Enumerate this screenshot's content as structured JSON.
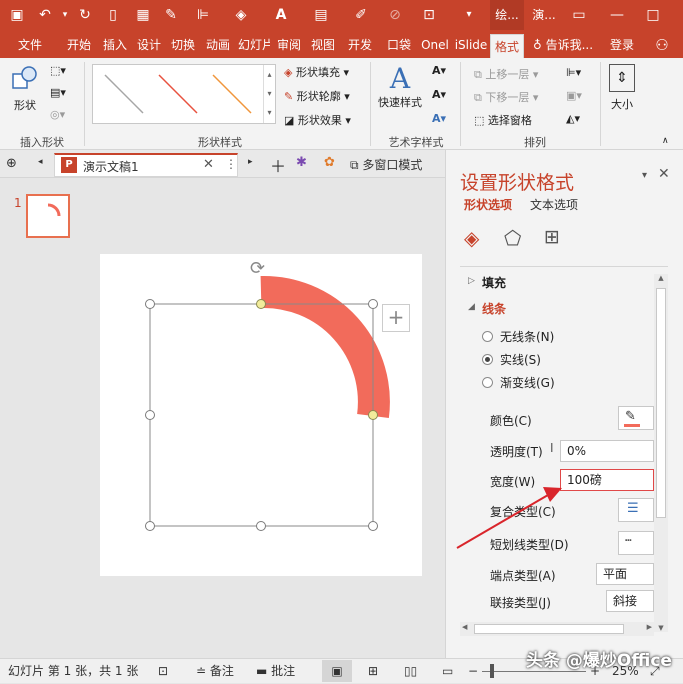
{
  "window": {
    "context_tabs": [
      "绘...",
      "演..."
    ],
    "quick_access_icons": [
      "save-icon",
      "undo-icon",
      "redo-icon",
      "new-icon",
      "table-icon",
      "eyedropper-icon",
      "align-icon",
      "fill-icon",
      "font-color-icon",
      "paste-icon",
      "brush-icon",
      "circle-icon",
      "screen-icon"
    ],
    "restore_icon": "restore-icon",
    "minimize_icon": "minimize-icon",
    "close_icon": "close-icon"
  },
  "ribbon_tabs": [
    "文件",
    "开始",
    "插入",
    "设计",
    "切换",
    "动画",
    "幻灯片",
    "审阅",
    "视图",
    "开发",
    "口袋",
    "Onel",
    "iSlide",
    "格式"
  ],
  "active_tab": "格式",
  "tell_me": "告诉我...",
  "login": "登录",
  "ribbon": {
    "insert_shape": {
      "shape_label": "形状",
      "group_label": "插入形状"
    },
    "shape_styles": {
      "fill": "形状填充",
      "outline": "形状轮廓",
      "effect": "形状效果",
      "group_label": "形状样式",
      "style_colors": [
        "#a6a6a6",
        "#e8523f",
        "#f0963c"
      ]
    },
    "wordart": {
      "quick_styles": "快速样式",
      "group_label": "艺术字样式"
    },
    "arrange": {
      "bring_forward": "上移一层",
      "send_backward": "下移一层",
      "selection_pane": "选择窗格",
      "group_label": "排列"
    },
    "size": {
      "label": "大小"
    }
  },
  "doc_tabs": {
    "file_name": "演示文稿1",
    "multi_window": "多窗口模式"
  },
  "slides": {
    "number": "1"
  },
  "panel": {
    "title": "设置形状格式",
    "tab_shape": "形状选项",
    "tab_text": "文本选项",
    "section_fill": "填充",
    "section_line": "线条",
    "options": [
      "无线条(N)",
      "实线(S)",
      "渐变线(G)"
    ],
    "selected_option": "实线(S)",
    "color_label": "颜色(C)",
    "transparency_label": "透明度(T)",
    "transparency_value": "0%",
    "width_label": "宽度(W)",
    "width_value": "100磅",
    "compound_label": "复合类型(C)",
    "dash_label": "短划线类型(D)",
    "cap_label": "端点类型(A)",
    "cap_value": "平面",
    "join_label": "联接类型(J)",
    "join_value": "斜接"
  },
  "shape": {
    "color": "#f26b5b"
  },
  "status": {
    "slide_info": "幻灯片 第 1 张，共 1 张",
    "notes": "备注",
    "comments": "批注",
    "zoom": "25%",
    "watermark": "头条 @爆炒Office"
  },
  "accent": "#c7432b",
  "annotation_arrow_color": "#d9252b"
}
